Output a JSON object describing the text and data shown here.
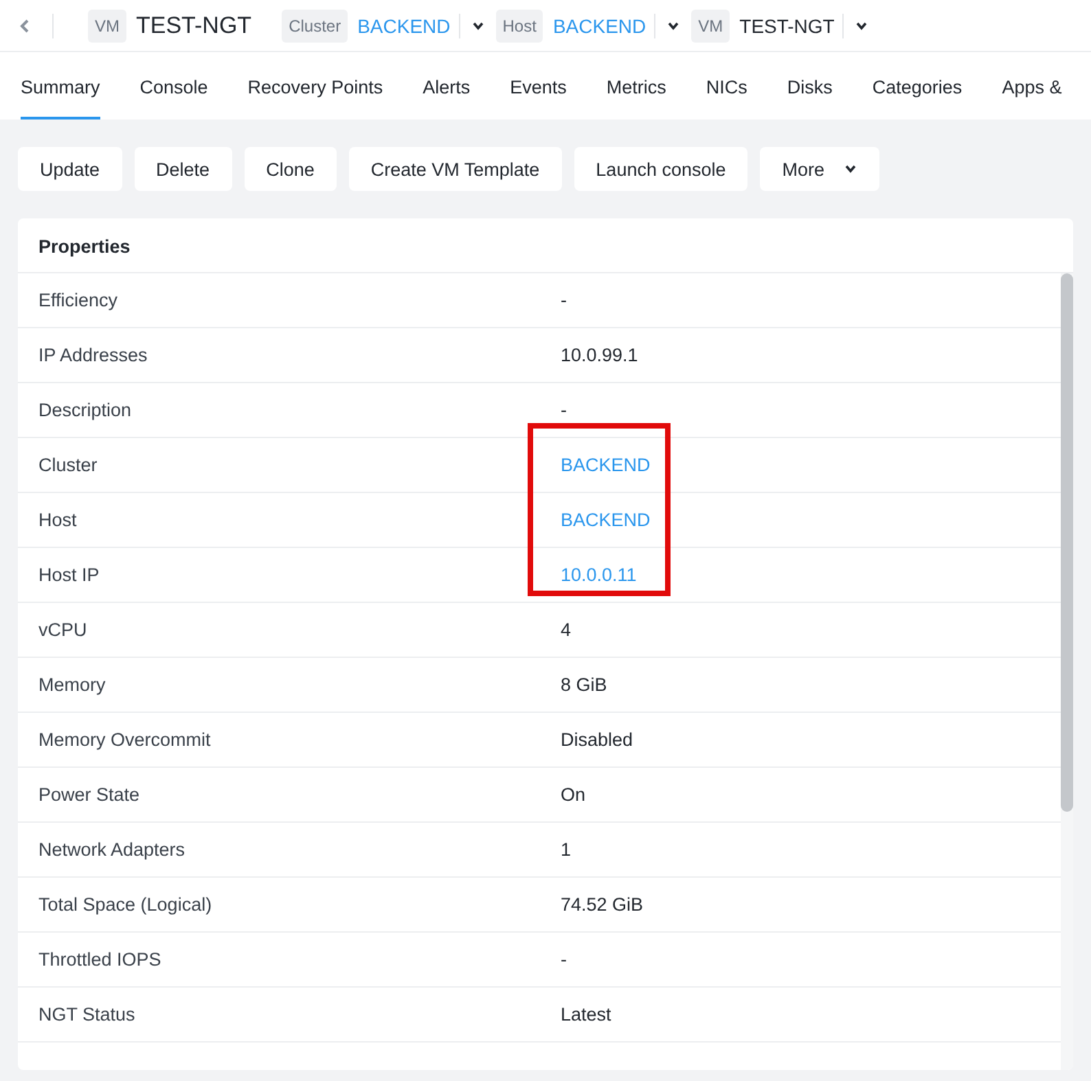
{
  "breadcrumb": [
    {
      "badge": "VM",
      "name": "TEST-NGT",
      "kind": "title"
    },
    {
      "badge": "Cluster",
      "name": "BACKEND",
      "kind": "link"
    },
    {
      "badge": "Host",
      "name": "BACKEND",
      "kind": "link"
    },
    {
      "badge": "VM",
      "name": "TEST-NGT",
      "kind": "plain"
    }
  ],
  "tabs": [
    {
      "label": "Summary",
      "selected": true
    },
    {
      "label": "Console",
      "selected": false
    },
    {
      "label": "Recovery Points",
      "selected": false
    },
    {
      "label": "Alerts",
      "selected": false
    },
    {
      "label": "Events",
      "selected": false
    },
    {
      "label": "Metrics",
      "selected": false
    },
    {
      "label": "NICs",
      "selected": false
    },
    {
      "label": "Disks",
      "selected": false
    },
    {
      "label": "Categories",
      "selected": false
    },
    {
      "label": "Apps &",
      "selected": false
    }
  ],
  "actions": [
    {
      "label": "Update",
      "kind": "plain"
    },
    {
      "label": "Delete",
      "kind": "plain"
    },
    {
      "label": "Clone",
      "kind": "plain"
    },
    {
      "label": "Create VM Template",
      "kind": "plain"
    },
    {
      "label": "Launch console",
      "kind": "plain"
    },
    {
      "label": "More",
      "kind": "menu"
    }
  ],
  "properties": {
    "title": "Properties",
    "rows": [
      {
        "label": "Efficiency",
        "value": "-",
        "kind": "text",
        "highlighted": false
      },
      {
        "label": "IP Addresses",
        "value": "10.0.99.1",
        "kind": "text",
        "highlighted": false
      },
      {
        "label": "Description",
        "value": "-",
        "kind": "text",
        "highlighted": false
      },
      {
        "label": "Cluster",
        "value": "BACKEND",
        "kind": "link",
        "highlighted": true
      },
      {
        "label": "Host",
        "value": "BACKEND",
        "kind": "link",
        "highlighted": true
      },
      {
        "label": "Host IP",
        "value": "10.0.0.11",
        "kind": "link",
        "highlighted": true
      },
      {
        "label": "vCPU",
        "value": "4",
        "kind": "text",
        "highlighted": false
      },
      {
        "label": "Memory",
        "value": "8 GiB",
        "kind": "text",
        "highlighted": false
      },
      {
        "label": "Memory Overcommit",
        "value": "Disabled",
        "kind": "text",
        "highlighted": false
      },
      {
        "label": "Power State",
        "value": "On",
        "kind": "text",
        "highlighted": false
      },
      {
        "label": "Network Adapters",
        "value": "1",
        "kind": "text",
        "highlighted": false
      },
      {
        "label": "Total Space (Logical)",
        "value": "74.52 GiB",
        "kind": "text",
        "highlighted": false
      },
      {
        "label": "Throttled IOPS",
        "value": "-",
        "kind": "text",
        "highlighted": false
      },
      {
        "label": "NGT Status",
        "value": "Latest",
        "kind": "text",
        "highlighted": false
      }
    ]
  }
}
